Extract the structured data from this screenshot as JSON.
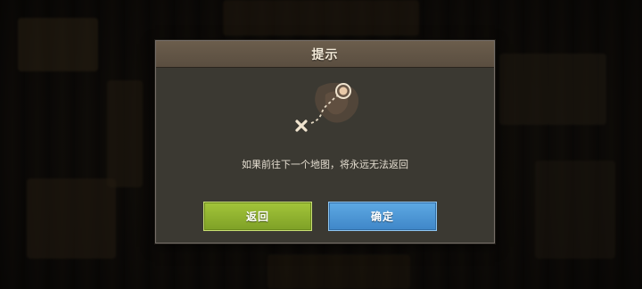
{
  "dialog": {
    "title": "提示",
    "message": "如果前往下一个地图，将永远无法返回",
    "back_button": "返回",
    "confirm_button": "确定"
  },
  "icons": {
    "map_route": "map-route-icon",
    "destination": "destination-marker-icon",
    "origin": "x-mark-icon"
  },
  "colors": {
    "back_button": "#8db02e",
    "confirm_button": "#4b93d3",
    "header": "#625545",
    "dialog_bg": "#3b3932"
  }
}
